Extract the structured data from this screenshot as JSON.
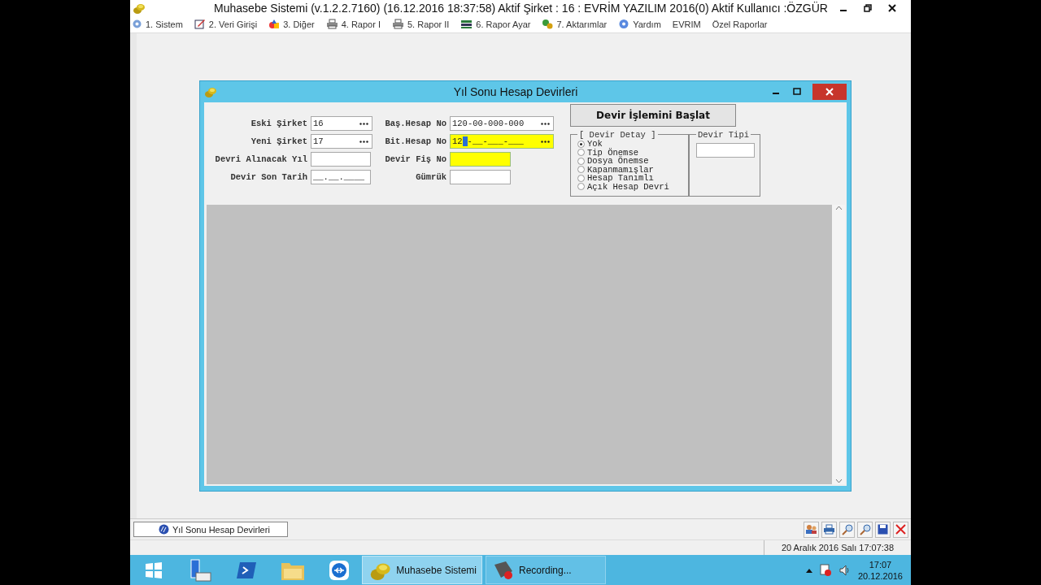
{
  "window": {
    "title": "Muhasebe Sistemi (v.1.2.2.7160) (16.12.2016 18:37:58) Aktif Şirket : 16 : EVRİM YAZILIM 2016(0) Aktif Kullanıcı :ÖZGÜR"
  },
  "menu": [
    {
      "label": "1.  Sistem",
      "has_icon": true
    },
    {
      "label": "2.  Veri Girişi",
      "has_icon": true
    },
    {
      "label": "3.  Diğer",
      "has_icon": true
    },
    {
      "label": "4.  Rapor I",
      "has_icon": true
    },
    {
      "label": "5.  Rapor II",
      "has_icon": true
    },
    {
      "label": "6.  Rapor Ayar",
      "has_icon": true
    },
    {
      "label": "7.  Aktarımlar",
      "has_icon": true
    },
    {
      "label": "Yardım",
      "has_icon": true
    },
    {
      "label": "EVRIM",
      "has_icon": false
    },
    {
      "label": "Özel Raporlar",
      "has_icon": false
    }
  ],
  "dialog": {
    "title": "Yıl Sonu Hesap Devirleri",
    "left_fields": [
      {
        "label": "Eski Şirket",
        "value": "16",
        "kind": "lookup",
        "highlighted": false
      },
      {
        "label": "Yeni Şirket",
        "value": "17",
        "kind": "lookup",
        "highlighted": false
      },
      {
        "label": "Devri Alınacak Yıl",
        "kind": "plain",
        "highlighted": false
      },
      {
        "label": "Devir Son Tarih",
        "value": "__.__.____",
        "kind": "plain",
        "highlighted": false
      }
    ],
    "right_fields": [
      {
        "label": "Baş.Hesap No",
        "value": "120-00-000-000",
        "kind": "lookup",
        "highlighted": false
      },
      {
        "label": "Bit.Hesap No",
        "value": "12",
        "mask": "-__-___-___",
        "kind": "lookup",
        "highlighted": true
      },
      {
        "label": "Devir Fiş No",
        "kind": "plain",
        "highlighted": true
      },
      {
        "label": "Gümrük",
        "kind": "plain",
        "highlighted": false
      }
    ],
    "start_button": "Devir İşlemini Başlat",
    "detail_group": {
      "title": "[ Devir Detay ]",
      "options": [
        {
          "label": "Yok",
          "selected": true
        },
        {
          "label": "Tip Önemse",
          "selected": false
        },
        {
          "label": "Dosya Önemse",
          "selected": false
        },
        {
          "label": "Kapanmamışlar",
          "selected": false
        },
        {
          "label": "Hesap Tanımlı",
          "selected": false
        },
        {
          "label": "Açık Hesap Devri",
          "selected": false
        }
      ]
    },
    "type_group": {
      "title": "Devir Tipi"
    }
  },
  "doc_tabs": [
    {
      "label": "Yıl Sonu Hesap Devirleri",
      "selected": true
    }
  ],
  "status_bar": "20 Aralık 2016 Salı 17:07:38",
  "taskbar": {
    "tasks": [
      {
        "label": "Muhasebe Sistemi",
        "selected": true
      },
      {
        "label": "Recording...",
        "selected": false
      }
    ],
    "time": "17:07",
    "date": "20.12.2016"
  }
}
